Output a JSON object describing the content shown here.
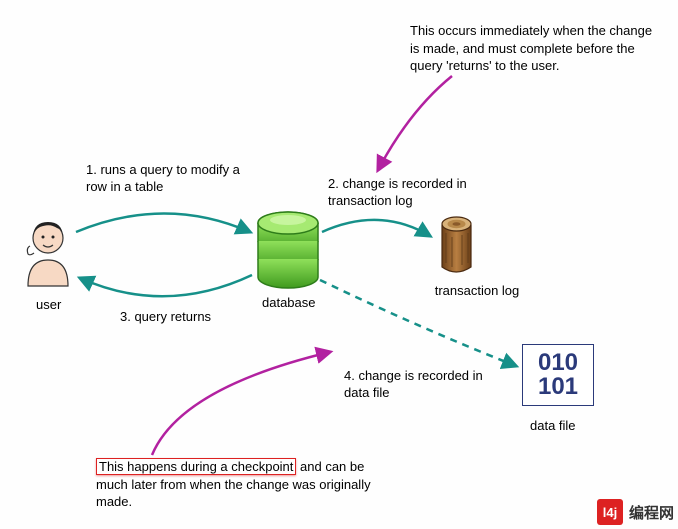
{
  "nodes": {
    "user": "user",
    "database": "database",
    "transaction_log": "transaction log",
    "data_file": "data file"
  },
  "steps": {
    "s1": "1. runs a query to modify a row in a table",
    "s2": "2. change is recorded in transaction log",
    "s3": "3. query returns",
    "s4": "4. change is recorded in data file"
  },
  "notes": {
    "top": "This occurs immediately when the change is made, and must complete before the query 'returns' to the user.",
    "bottom_highlight": "This happens during a checkpoint",
    "bottom_rest": " and can be much later from when the change was originally made."
  },
  "data_file_glyph": "010\n101",
  "watermark": "编程网",
  "colors": {
    "teal": "#169089",
    "magenta": "#b221a0",
    "db_green": "#5fb82f",
    "log_brown": "#8a5a2a",
    "binary_blue": "#2b3a7a"
  }
}
